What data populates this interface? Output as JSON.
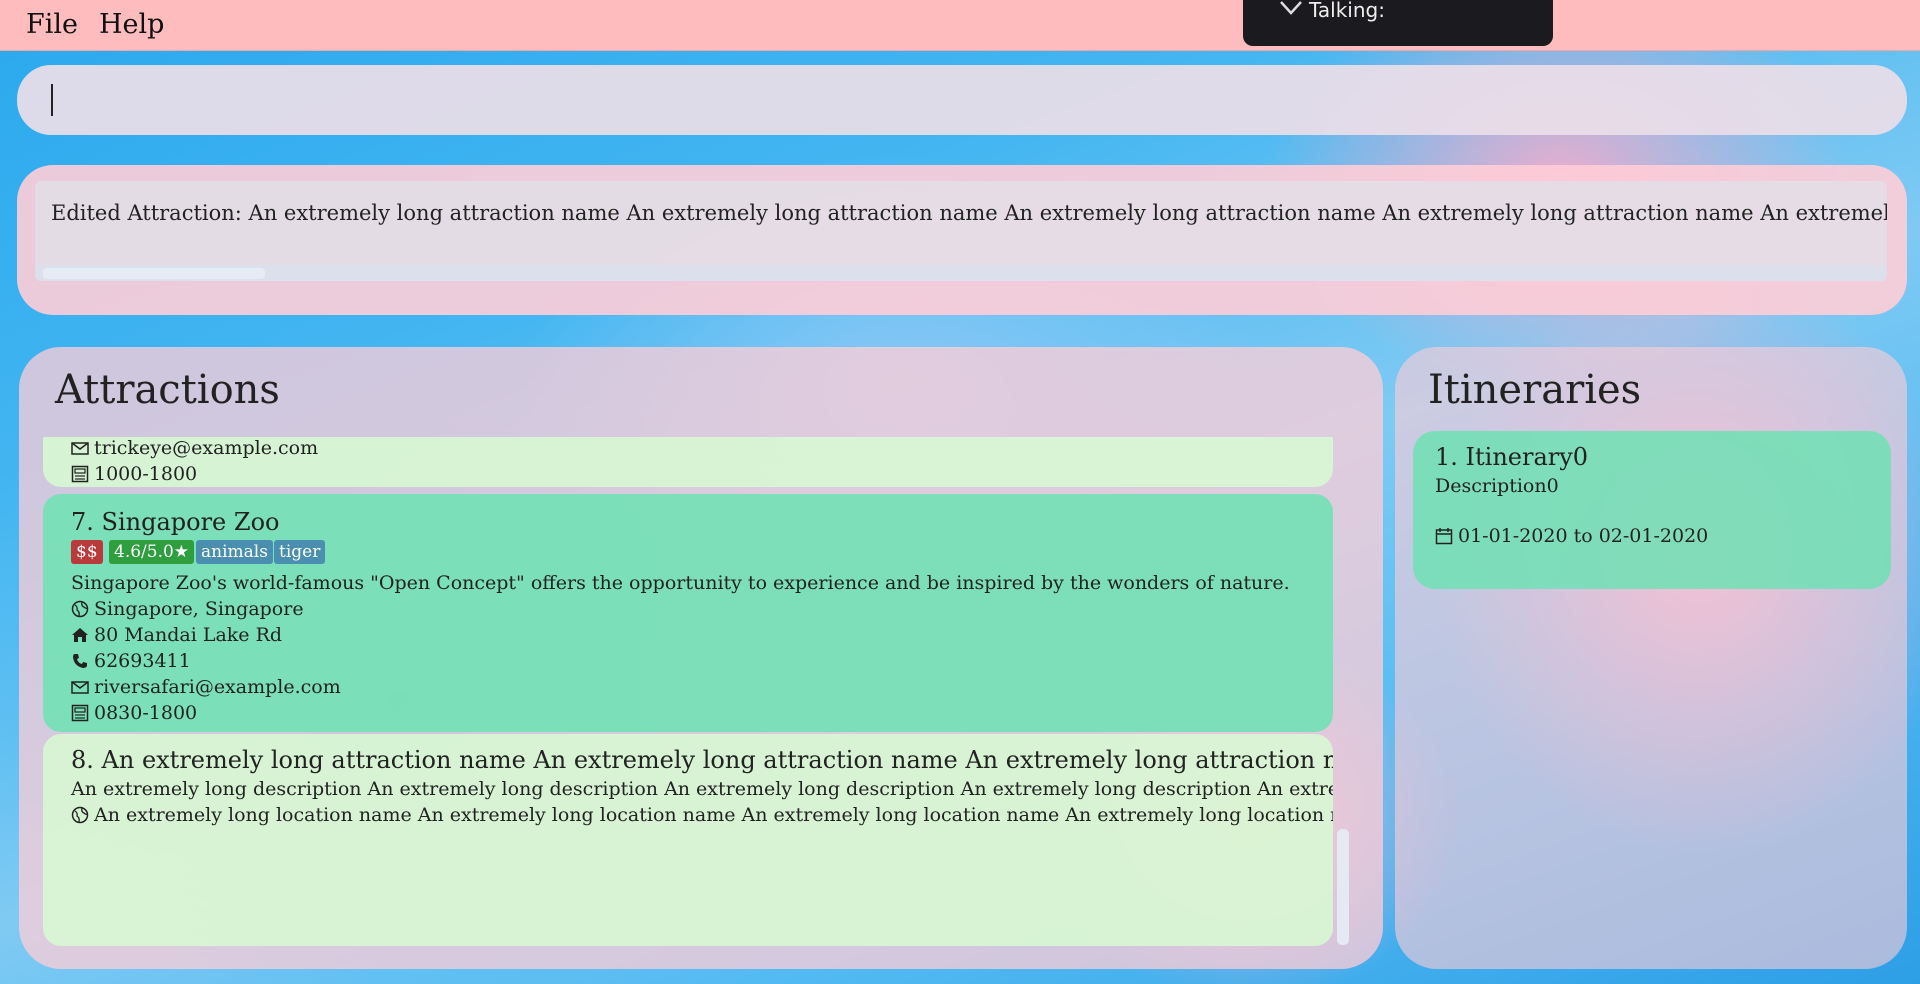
{
  "menu": {
    "file": "File",
    "help": "Help"
  },
  "overlay": {
    "talking_label": "Talking:"
  },
  "command": {
    "value": "",
    "placeholder": ""
  },
  "result": {
    "text": "Edited Attraction: An extremely long attraction name An extremely long attraction name An extremely long attraction name An extremely long attraction name An extremely long attraction"
  },
  "attractions": {
    "title": "Attractions",
    "partial_card": {
      "email": "trickeye@example.com",
      "hours": "1000-1800"
    },
    "cards": [
      {
        "title": "7.  Singapore Zoo",
        "price": "$$",
        "rating": "4.6/5.0★",
        "tags": [
          "animals",
          "tiger"
        ],
        "description": "Singapore Zoo's world-famous \"Open Concept\" offers the opportunity to experience and be inspired by the wonders of nature.",
        "location": "Singapore, Singapore",
        "address": "80 Mandai Lake Rd",
        "phone": "62693411",
        "email": "riversafari@example.com",
        "hours": "0830-1800"
      },
      {
        "title": "8.  An extremely long attraction name An extremely long attraction name An extremely long attraction name An ex...",
        "description": "An extremely long description An extremely long description An extremely long description An extremely long description An extremely long...",
        "location": "An extremely long location name An extremely long location name An extremely long location name An extremely long location name An e..."
      }
    ]
  },
  "itineraries": {
    "title": "Itineraries",
    "items": [
      {
        "title": "1.  Itinerary0",
        "description": "Description0",
        "dates": "01-01-2020 to 02-01-2020"
      }
    ]
  },
  "colors": {
    "menubar": "#ffbcbe",
    "card_green": "#6fe0b4",
    "card_light": "#d9f9d6",
    "tag_price": "#b83a3a",
    "tag_rating": "#2e9e3e",
    "tag_blue": "#4a8fb0"
  }
}
